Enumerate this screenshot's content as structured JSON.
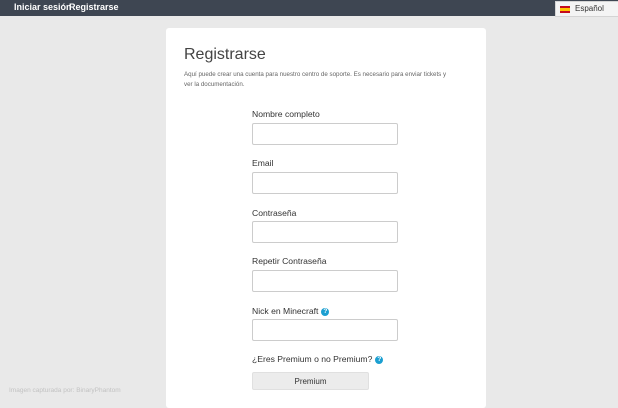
{
  "topbar": {
    "login_label": "Iniciar sesión",
    "register_label": "Registrarse",
    "language_label": "Español",
    "language_icon": "spain-flag-icon"
  },
  "form": {
    "title": "Registrarse",
    "intro": "Aquí puede crear una cuenta para nuestro centro de soporte. Es necesario para enviar tickets y ver la documentación.",
    "fields": [
      {
        "label": "Nombre completo",
        "value": ""
      },
      {
        "label": "Email",
        "value": ""
      },
      {
        "label": "Contraseña",
        "value": ""
      },
      {
        "label": "Repetir Contraseña",
        "value": ""
      },
      {
        "label": "Nick en Minecraft",
        "value": "",
        "help_icon": "question-icon"
      }
    ],
    "premium_question": "¿Eres Premium o no Premium?",
    "premium_option": "Premium"
  },
  "footer": {
    "watermark": "Imagen capturada por: BinaryPhantom"
  },
  "colors": {
    "topbar_bg": "#3e4652",
    "page_bg": "#e9e9e9",
    "help_icon": "#1b9fd1"
  }
}
